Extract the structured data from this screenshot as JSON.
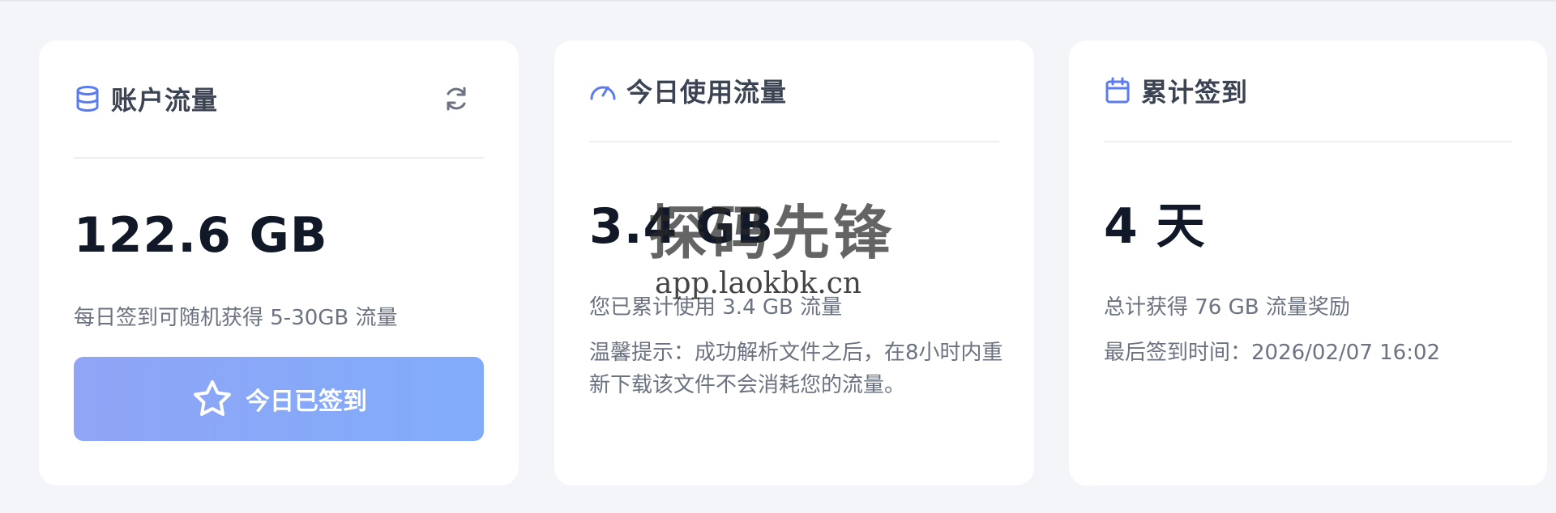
{
  "cards": [
    {
      "icon": "database-icon",
      "title": "账户流量",
      "value": "122.6 GB",
      "description": "每日签到可随机获得 5-30GB 流量",
      "button_label": "今日已签到",
      "button_icon": "star-icon",
      "refresh_icon": "refresh-icon"
    },
    {
      "icon": "speedometer-icon",
      "title": "今日使用流量",
      "value": "3.4 GB",
      "description": "您已累计使用 3.4 GB 流量",
      "tip": "温馨提示：成功解析文件之后，在8小时内重新下载该文件不会消耗您的流量。"
    },
    {
      "icon": "calendar-icon",
      "title": "累计签到",
      "value": "4 天",
      "description": "总计获得 76 GB 流量奖励",
      "last_checkin": "最后签到时间：2026/02/07 16:02"
    }
  ],
  "watermark": {
    "brand": "探码先锋",
    "url": "app.laokbk.cn"
  },
  "colors": {
    "accent": "#5b7cf0",
    "button_gradient_start": "#8aa0f6",
    "button_gradient_end": "#7aa8fa"
  }
}
